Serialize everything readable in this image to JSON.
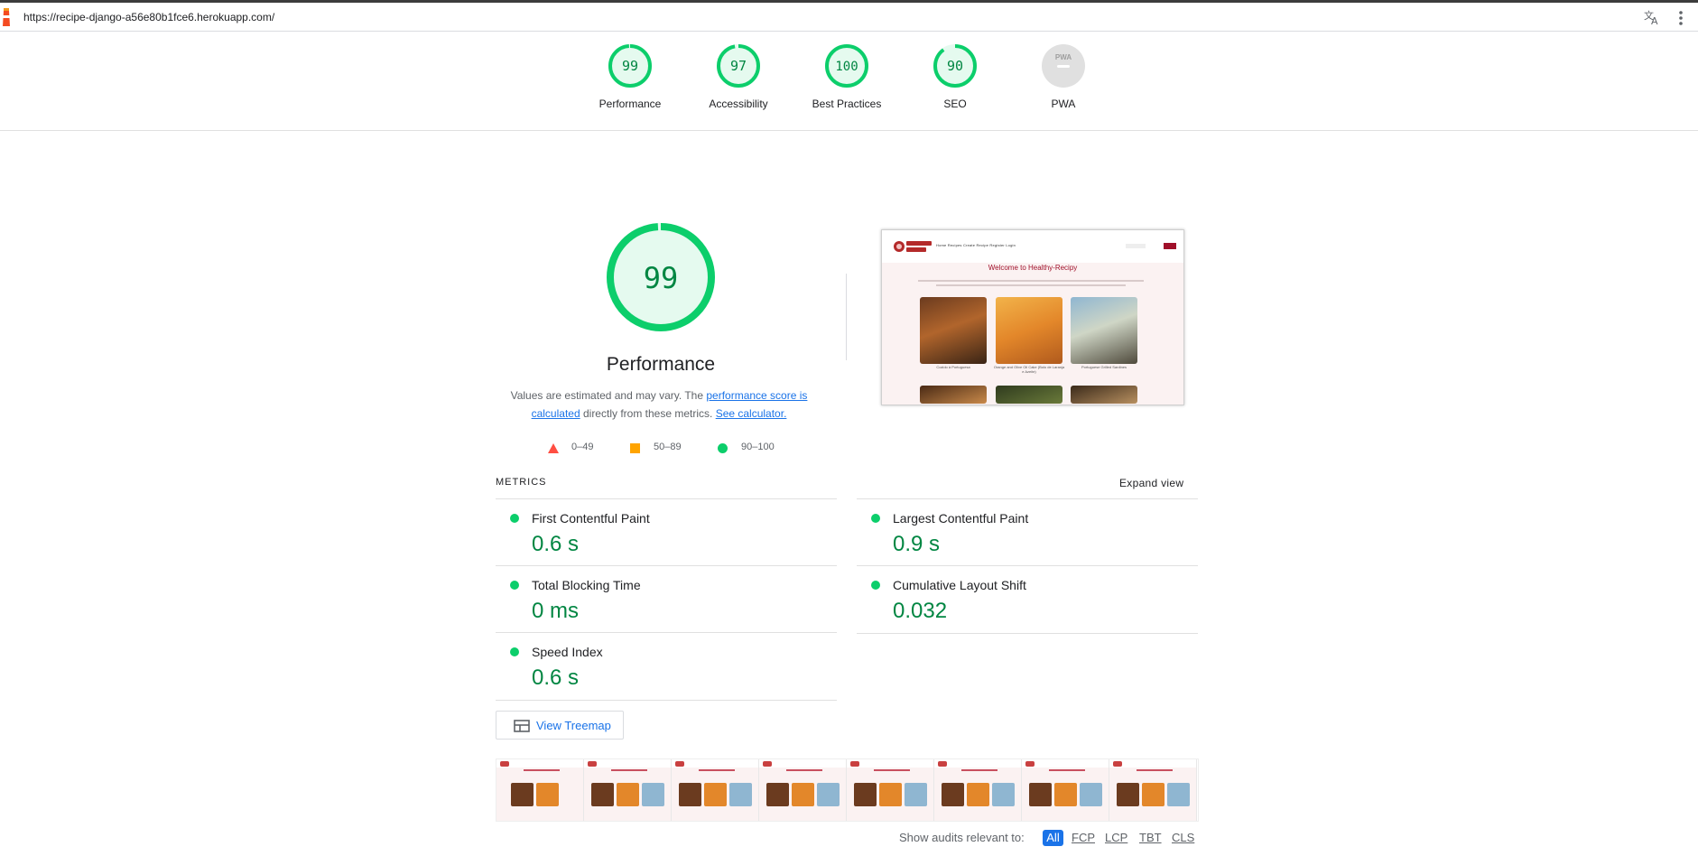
{
  "browser": {
    "url": "https://recipe-django-a56e80b1fce6.herokuapp.com/"
  },
  "summary": [
    {
      "label": "Performance",
      "score": "99",
      "value": 99
    },
    {
      "label": "Accessibility",
      "score": "97",
      "value": 97
    },
    {
      "label": "Best Practices",
      "score": "100",
      "value": 100
    },
    {
      "label": "SEO",
      "score": "90",
      "value": 90
    },
    {
      "label": "PWA",
      "score": "",
      "value": null,
      "badge": "PWA"
    }
  ],
  "performance": {
    "score": "99",
    "value": 99,
    "title": "Performance",
    "desc_prefix": "Values are estimated and may vary. The ",
    "desc_link1": "performance score is calculated",
    "desc_middle": " directly from these metrics. ",
    "desc_link2": "See calculator."
  },
  "legend": [
    {
      "range": "0–49",
      "shape": "triangle",
      "color": "#ff4e42"
    },
    {
      "range": "50–89",
      "shape": "square",
      "color": "#ffa400"
    },
    {
      "range": "90–100",
      "shape": "circle",
      "color": "#0cce6b"
    }
  ],
  "screenshot": {
    "nav_links": "Home   Recipes   Create Recipe   Register   Login",
    "title": "Welcome to Healthy-Recipy",
    "captions": [
      "Cozido à Portuguesa",
      "Orange and Olive Oil Cake (Bolo de Laranja e Azeite)",
      "Portuguese Grilled Sardines"
    ]
  },
  "metrics": {
    "heading": "METRICS",
    "expand_label": "Expand view",
    "items": [
      {
        "name": "First Contentful Paint",
        "value": "0.6 s"
      },
      {
        "name": "Largest Contentful Paint",
        "value": "0.9 s"
      },
      {
        "name": "Total Blocking Time",
        "value": "0 ms"
      },
      {
        "name": "Cumulative Layout Shift",
        "value": "0.032"
      },
      {
        "name": "Speed Index",
        "value": "0.6 s"
      }
    ]
  },
  "treemap": {
    "label": "View Treemap"
  },
  "filter": {
    "label": "Show audits relevant to:",
    "chips": [
      "All",
      "FCP",
      "LCP",
      "TBT",
      "CLS"
    ],
    "active": "All"
  },
  "colors": {
    "pass": "#0cce6b",
    "pass_text": "#018642",
    "pass_fill": "#e5faef",
    "link": "#1a73e8"
  }
}
